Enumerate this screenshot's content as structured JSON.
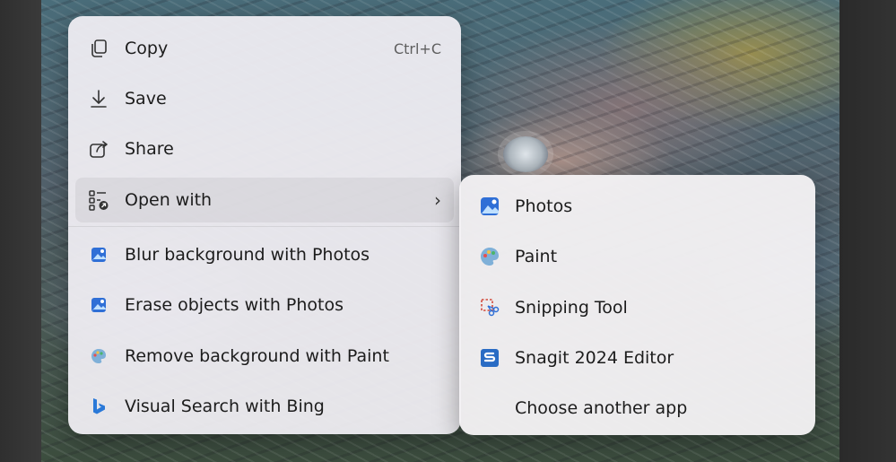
{
  "context_menu": {
    "items": [
      {
        "label": "Copy",
        "shortcut": "Ctrl+C",
        "icon": "copy-icon"
      },
      {
        "label": "Save",
        "icon": "download-icon"
      },
      {
        "label": "Share",
        "icon": "share-icon"
      },
      {
        "label": "Open with",
        "icon": "open-with-icon",
        "has_submenu": true,
        "submenu_arrow": "›"
      },
      {
        "label": "Blur background with Photos",
        "icon": "photos-icon"
      },
      {
        "label": "Erase objects with Photos",
        "icon": "photos-icon"
      },
      {
        "label": "Remove background with Paint",
        "icon": "paint-icon"
      },
      {
        "label": "Visual Search with Bing",
        "icon": "bing-icon"
      }
    ]
  },
  "open_with_submenu": {
    "items": [
      {
        "label": "Photos",
        "icon": "photos-icon"
      },
      {
        "label": "Paint",
        "icon": "paint-icon"
      },
      {
        "label": "Snipping Tool",
        "icon": "snipping-tool-icon"
      },
      {
        "label": "Snagit 2024 Editor",
        "icon": "snagit-icon"
      },
      {
        "label": "Choose another app",
        "icon": ""
      }
    ]
  },
  "colors": {
    "menu_bg": "#f0eef3",
    "text": "#1c1c1c",
    "photos_blue": "#2f6fd6",
    "snagit_blue": "#2a6cc4",
    "bing_blue": "#2a79d8"
  }
}
